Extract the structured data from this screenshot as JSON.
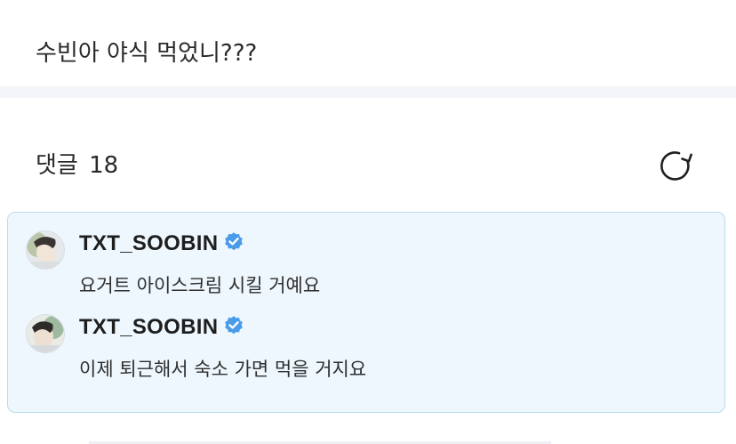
{
  "post": {
    "text": "수빈아 야식 먹었니???"
  },
  "comments_section": {
    "label": "댓글",
    "count": "18",
    "refresh_icon": "refresh-icon"
  },
  "colors": {
    "highlight_bg": "#eef7fd",
    "highlight_border": "#b9dcef",
    "verified_blue": "#4a9be8",
    "divider": "#f4f5f8"
  },
  "comments": [
    {
      "username": "TXT_SOOBIN",
      "verified": true,
      "text": "요거트 아이스크림 시킬 거예요"
    },
    {
      "username": "TXT_SOOBIN",
      "verified": true,
      "text": "이제 퇴근해서 숙소 가면 먹을 거지요"
    }
  ]
}
